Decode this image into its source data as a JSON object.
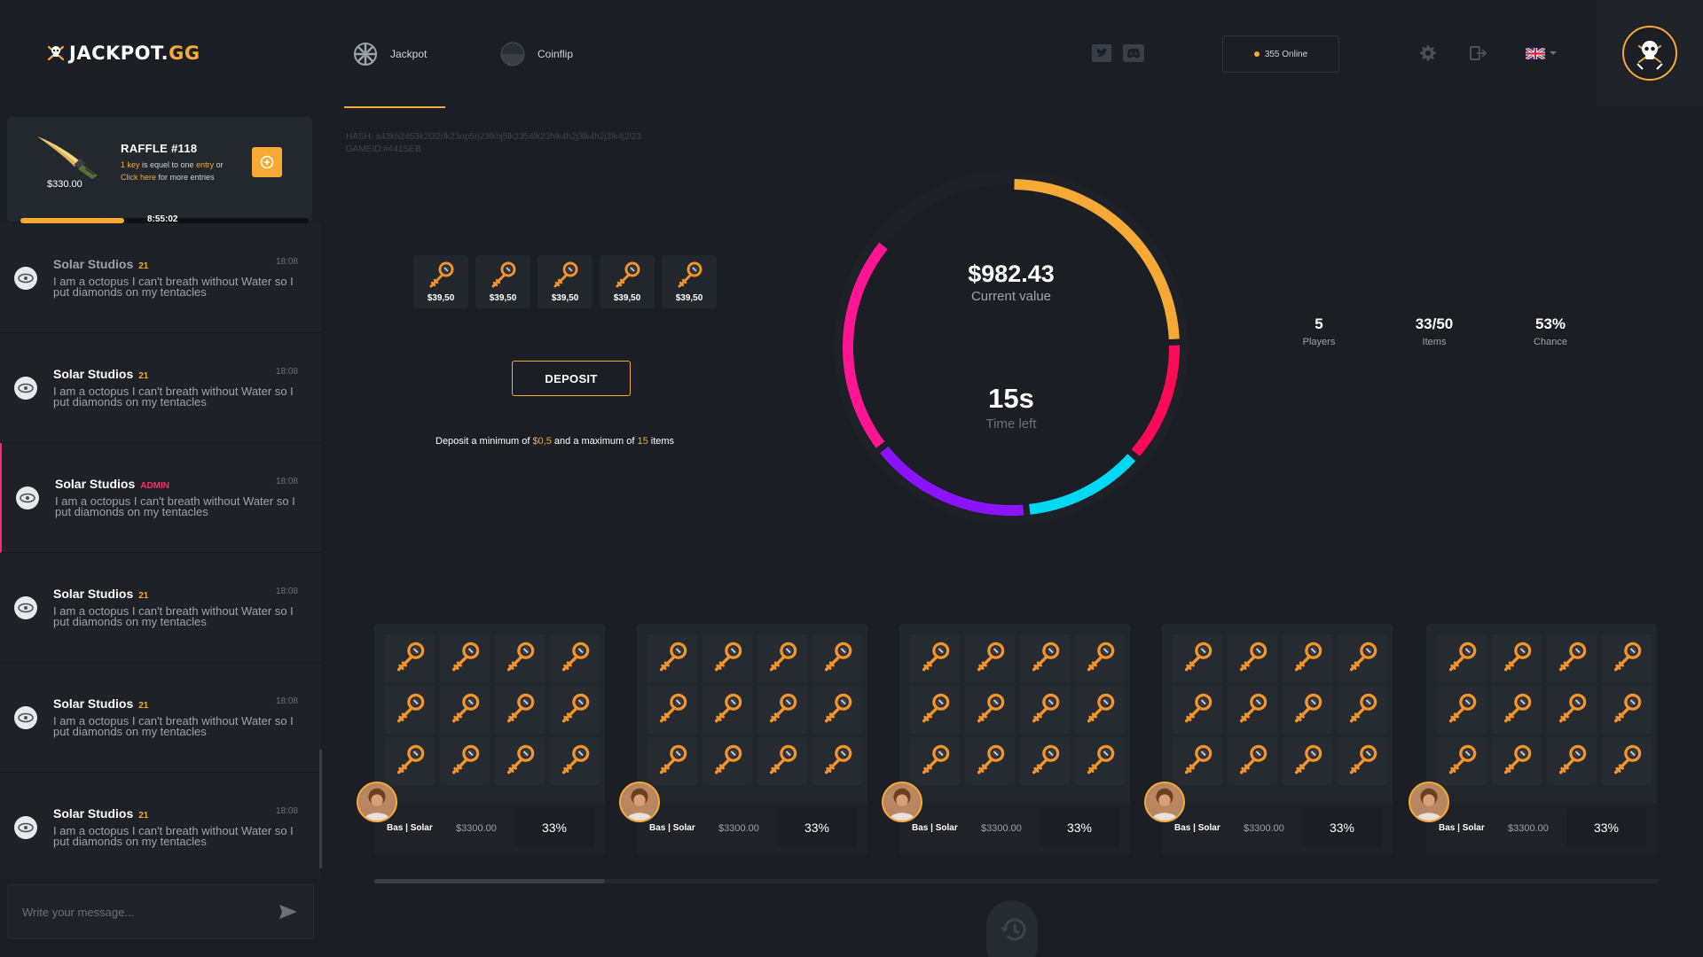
{
  "header": {
    "logo_main": "JACKPOT.",
    "logo_accent": "GG",
    "nav": [
      {
        "label": "Jackpot",
        "active": true
      },
      {
        "label": "Coinflip",
        "active": false
      }
    ],
    "online_text": "355 Online",
    "icons": [
      "twitter-icon",
      "discord-icon",
      "gear-icon",
      "logout-icon",
      "uk-flag-icon",
      "chevron-down-icon"
    ]
  },
  "raffle": {
    "title": "RAFFLE #118",
    "price": "$330.00",
    "line1_a": "1 key",
    "line1_b": " is equel to one ",
    "line1_c": "entry",
    "line1_d": "  or",
    "line2_a": "Click here",
    "line2_b": " for more entries",
    "timer": "8:55:02",
    "progress": 0.36
  },
  "messages": [
    {
      "name": "Solar Studios",
      "level": "21",
      "time": "18:08",
      "text": "I am a octopus I can't breath without Water so I put diamonds on my tentacles",
      "admin": false
    },
    {
      "name": "Solar Studios",
      "level": "21",
      "time": "18:08",
      "text": "I am a octopus I can't breath without Water so I put diamonds on my tentacles",
      "admin": false
    },
    {
      "name": "Solar Studios",
      "level": "ADMIN",
      "time": "18:08",
      "text": "I am a octopus I can't breath without Water so I put diamonds on my tentacles",
      "admin": true
    },
    {
      "name": "Solar Studios",
      "level": "21",
      "time": "18:08",
      "text": "I am a octopus I can't breath without Water so I put diamonds on my tentacles",
      "admin": false
    },
    {
      "name": "Solar Studios",
      "level": "21",
      "time": "18:08",
      "text": "I am a octopus I can't breath without Water so I put diamonds on my tentacles",
      "admin": false
    },
    {
      "name": "Solar Studios",
      "level": "21",
      "time": "18:08",
      "text": "I am a octopus I can't breath without Water so I put diamonds on my tentacles",
      "admin": false
    }
  ],
  "chat": {
    "placeholder": "Write your message..."
  },
  "game": {
    "hash": "HASH: a43kh2453k2l32rlk23op5rj23lkhj5lk2354lk23hlk4h2j3lk4h2j3lk4j2l23",
    "gameid": "GAMEID:#441SEB",
    "keys": [
      "$39,50",
      "$39,50",
      "$39,50",
      "$39,50",
      "$39,50"
    ],
    "deposit_label": "DEPOSIT",
    "note_a": "Deposit a minimum of ",
    "note_min": "$0,5",
    "note_b": " and a maximum of ",
    "note_max": "15",
    "note_c": " items"
  },
  "wheel": {
    "value": "$982.43",
    "value_label": "Current value",
    "time": "15s",
    "time_label": "Time left",
    "segments": [
      {
        "color": "#f7a935",
        "share": 0.245
      },
      {
        "color": "#ff0a54",
        "share": 0.12
      },
      {
        "color": "#00d9f5",
        "share": 0.12
      },
      {
        "color": "#8a14ff",
        "share": 0.16
      },
      {
        "color": "#ff1493",
        "share": 0.215
      }
    ]
  },
  "stats": [
    {
      "value": "5",
      "label": "Players"
    },
    {
      "value": "33/50",
      "label": "Items"
    },
    {
      "value": "53%",
      "label": "Chance"
    }
  ],
  "deposits": [
    {
      "user": "Bas | Solar",
      "value": "$3300.00",
      "chance": "33%"
    },
    {
      "user": "Bas | Solar",
      "value": "$3300.00",
      "chance": "33%"
    },
    {
      "user": "Bas | Solar",
      "value": "$3300.00",
      "chance": "33%"
    },
    {
      "user": "Bas | Solar",
      "value": "$3300.00",
      "chance": "33%"
    },
    {
      "user": "Bas | Solar",
      "value": "$3300.00",
      "chance": "33%"
    }
  ],
  "colors": {
    "accent": "#f7a935",
    "admin": "#ff2a6d",
    "bg": "#1b1e24",
    "panel": "#22262d"
  }
}
